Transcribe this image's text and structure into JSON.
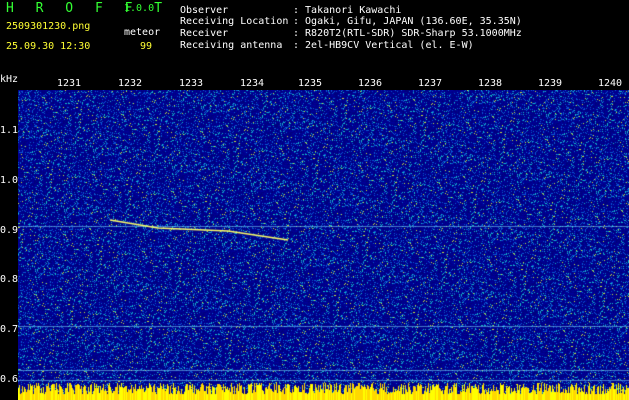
{
  "header": {
    "app_name": "H R O F F T",
    "version": "1.0.0",
    "filename": "2509301230.png",
    "datetime": "25.09.30 12:30",
    "mode_label": "meteor",
    "meteor_count": "99",
    "info_labels": [
      "Observer",
      "Receiving Location",
      "Receiver",
      "Receiving antenna"
    ],
    "info_values": [
      ": Takanori Kawachi",
      ": Ogaki, Gifu, JAPAN (136.60E, 35.35N)",
      ": R820T2(RTL-SDR) SDR-Sharp 53.1000MHz",
      ": 2el-HB9CV Vertical (el. E-W)"
    ]
  },
  "axes": {
    "y_unit": "kHz",
    "x_ticks": [
      "1231",
      "1232",
      "1233",
      "1234",
      "1235",
      "1236",
      "1237",
      "1238",
      "1239",
      "1240"
    ],
    "y_ticks": [
      "1.1",
      "1.0",
      "0.9",
      "0.8",
      "0.7",
      "0.6"
    ]
  },
  "colors": {
    "background": "#000000",
    "waterfall_base": "#00008a",
    "text_green": "#33ff33",
    "text_yellow": "#ffff33",
    "text_white": "#ffffff"
  }
}
